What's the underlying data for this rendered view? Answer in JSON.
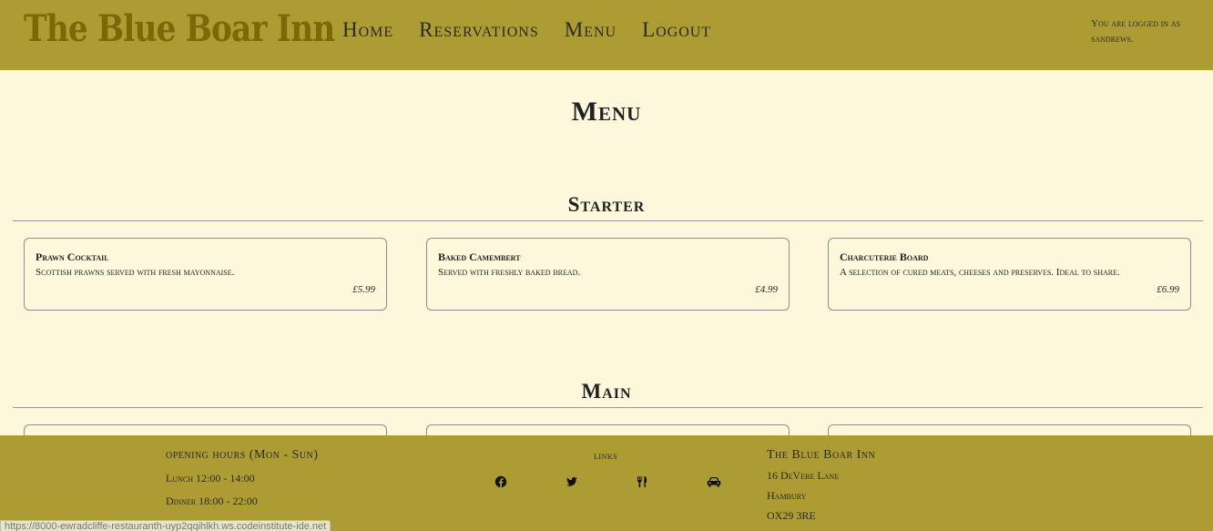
{
  "header": {
    "logo": "The Blue Boar Inn",
    "nav": [
      "Home",
      "Reservations",
      "Menu",
      "Logout"
    ],
    "login_status": "You are logged in as sandrews."
  },
  "main": {
    "title": "Menu",
    "sections": [
      {
        "title": "Starter",
        "items": [
          {
            "name": "Prawn Cocktail",
            "description": "Scottish prawns served with fresh mayonnaise.",
            "price": "£5.99"
          },
          {
            "name": "Baked Camembert",
            "description": "Served with freshly baked bread.",
            "price": "£4.99"
          },
          {
            "name": "Charcuterie Board",
            "description": "A selection of cured meats, cheeses and preserves. Ideal to share.",
            "price": "£6.99"
          }
        ]
      },
      {
        "title": "Main",
        "items": []
      }
    ]
  },
  "footer": {
    "hours_title": "opening hours (Mon - Sun)",
    "hours_lines": [
      "Lunch 12:00 - 14:00",
      "Dinner 18:00 - 22:00"
    ],
    "links_title": "links",
    "link_icons": [
      "facebook-icon",
      "twitter-icon",
      "cutlery-icon",
      "car-icon"
    ],
    "address_title": "The Blue Boar Inn",
    "address_lines": [
      "16 DeVere Lane",
      "Hambury",
      "OX29 3RE"
    ]
  },
  "status_bar": {
    "url": "https://8000-ewradcliffe-restauranth-uyp2qqihlkh.ws.codeinstitute-ide.net"
  }
}
